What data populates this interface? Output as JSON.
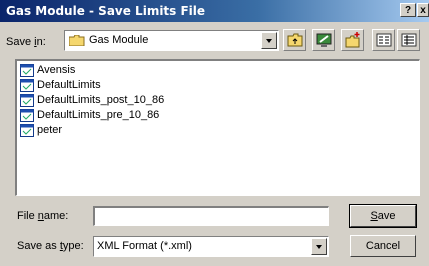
{
  "window": {
    "title": "Gas Module - Save Limits File"
  },
  "titlebar": {
    "help_glyph": "?",
    "close_glyph": "x"
  },
  "save_in": {
    "label_pre": "Save ",
    "label_u": "i",
    "label_post": "n:",
    "folder": "Gas Module"
  },
  "files": [
    {
      "name": "Avensis"
    },
    {
      "name": "DefaultLimits"
    },
    {
      "name": "DefaultLimits_post_10_86"
    },
    {
      "name": "DefaultLimits_pre_10_86"
    },
    {
      "name": "peter"
    }
  ],
  "file_name": {
    "label_pre": "File ",
    "label_u": "n",
    "label_post": "ame:",
    "value": ""
  },
  "save_as_type": {
    "label_pre": "Save as ",
    "label_u": "t",
    "label_post": "ype:",
    "value": "XML Format (*.xml)"
  },
  "buttons": {
    "save_u": "S",
    "save_rest": "ave",
    "cancel": "Cancel"
  },
  "colors": {
    "titlebar_start": "#0a246a",
    "titlebar_end": "#a6caf0",
    "dialog_bg": "#d4d0c8"
  }
}
